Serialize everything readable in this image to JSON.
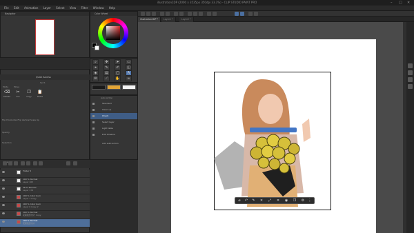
{
  "window": {
    "title": "illustration1DP (2000 x 3535px 350dpi 33.3%) - CLIP STUDIO PAINT PRO",
    "min_icon": "minimize-icon",
    "max_icon": "maximize-icon",
    "close_icon": "close-icon"
  },
  "menu": [
    "File",
    "Edit",
    "Animation",
    "Layer",
    "Select",
    "View",
    "Filter",
    "Window",
    "Help"
  ],
  "doc_tabs": [
    {
      "label": "illustration1DP *"
    },
    {
      "label": "Layer1 *"
    },
    {
      "label": "Layer2 *"
    }
  ],
  "navigator": {
    "title": "Navigator"
  },
  "color_wheel": {
    "title": "Color Wheel",
    "main_color": "#000000",
    "sub_color": "#ffffff"
  },
  "toolbox": {
    "tools": [
      {
        "icon": "magnifier-icon",
        "glyph": "⌕"
      },
      {
        "icon": "move-icon",
        "glyph": "✥"
      },
      {
        "icon": "operation-icon",
        "glyph": "➤"
      },
      {
        "icon": "selection-icon",
        "glyph": "▭"
      },
      {
        "icon": "eyedropper-icon",
        "glyph": "⌖"
      },
      {
        "icon": "pen-icon",
        "glyph": "✎"
      },
      {
        "icon": "brush-icon",
        "glyph": "✐"
      },
      {
        "icon": "eraser-icon",
        "glyph": "◫"
      },
      {
        "icon": "fill-icon",
        "glyph": "◈"
      },
      {
        "icon": "gradient-icon",
        "glyph": "▤"
      },
      {
        "icon": "figure-icon",
        "glyph": "◯"
      },
      {
        "icon": "text-icon",
        "glyph": "A"
      },
      {
        "icon": "balloon-icon",
        "glyph": "✉"
      },
      {
        "icon": "ruler-icon",
        "glyph": "⟋"
      },
      {
        "icon": "hand-icon",
        "glyph": "✋"
      },
      {
        "icon": "blend-icon",
        "glyph": "≈"
      }
    ]
  },
  "swatches": [
    "#1a1a1a",
    "#e3a536",
    "#f5f5f5"
  ],
  "quick_access": {
    "tab": "Quick Access",
    "set_label": "Set 1",
    "mode_label": "Mode",
    "move_label": "Move",
    "buttons": [
      {
        "icon": "delete-icon",
        "glyph": "⌫",
        "label": "Delete"
      },
      {
        "icon": "cut-icon",
        "glyph": "✂",
        "label": "Cut"
      },
      {
        "icon": "copy-icon",
        "glyph": "❐",
        "label": "Copy"
      },
      {
        "icon": "paste-icon",
        "glyph": "📋",
        "label": "Paste"
      }
    ],
    "row2_label": "Flip Horizontal  Flip Vertical  Scale Up",
    "specify_label": "Specify",
    "selection_label": "Selection"
  },
  "auto_action": {
    "tab": "Auto Action",
    "set": "Standard",
    "rows": [
      {
        "label": "Clean up",
        "selected": false
      },
      {
        "label": "Check",
        "selected": true
      },
      {
        "label": "Select layer",
        "selected": false
      },
      {
        "label": "Light table",
        "selected": false
      },
      {
        "label": "Edit timeline",
        "selected": false
      }
    ],
    "add_label": "Add auto action"
  },
  "layers": {
    "tab": "Layer",
    "items": [
      {
        "name": "Folder 5",
        "sub": "",
        "thumb": "white",
        "selected": false
      },
      {
        "name": "100 % Normal",
        "sub": "Layer 105",
        "thumb": "white",
        "selected": false
      },
      {
        "name": "28 % Normal",
        "sub": "Layer 178",
        "thumb": "white",
        "selected": false
      },
      {
        "name": "100 % Color burn",
        "sub": "Layer 7 Copy",
        "thumb": "red",
        "selected": false
      },
      {
        "name": "100 % Color burn",
        "sub": "Layer 6 Copy 2",
        "thumb": "red",
        "selected": false
      },
      {
        "name": "100 % Normal",
        "sub": "花束陰影付け Copy",
        "thumb": "red",
        "selected": false
      },
      {
        "name": "100 % Normal",
        "sub": "花束陰影付け",
        "thumb": "red",
        "selected": true
      }
    ]
  }
}
